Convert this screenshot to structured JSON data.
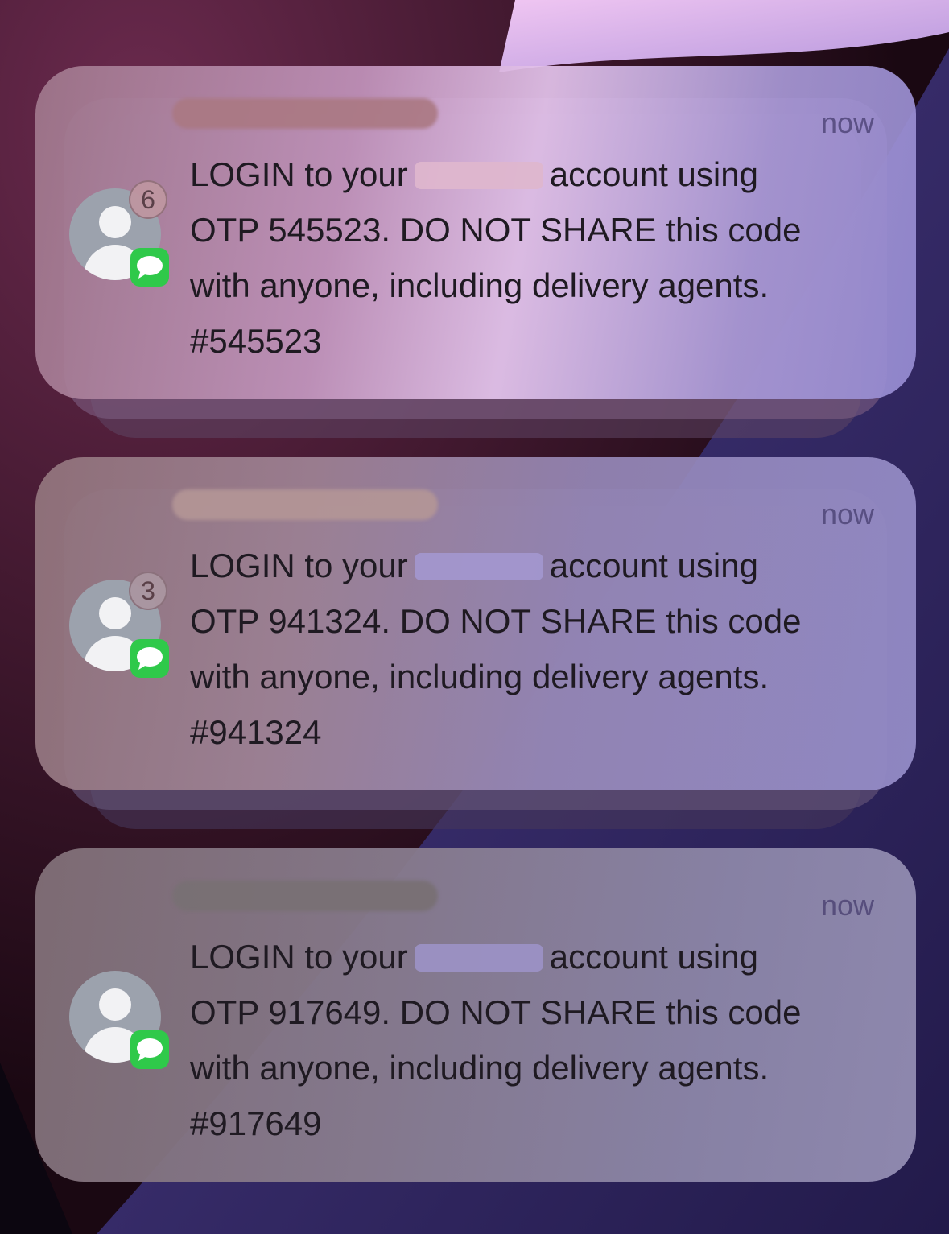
{
  "notifications": [
    {
      "time": "now",
      "count_badge": "6",
      "line1_start": "LOGIN to your",
      "line1_end": "account using",
      "line2": "OTP 545523. DO NOT SHARE this code",
      "line3": "with anyone, including delivery agents.",
      "line4": "#545523"
    },
    {
      "time": "now",
      "count_badge": "3",
      "line1_start": "LOGIN to your",
      "line1_end": "account using",
      "line2": "OTP 941324. DO NOT SHARE this code",
      "line3": "with anyone, including delivery agents.",
      "line4": "#941324"
    },
    {
      "time": "now",
      "line1_start": "LOGIN to your",
      "line1_end": "account using",
      "line2": "OTP 917649. DO NOT SHARE this code",
      "line3": "with anyone, including delivery agents.",
      "line4": "#917649"
    }
  ],
  "icons": {
    "avatar": "contact-avatar-icon",
    "app": "messages-app-icon"
  },
  "colors": {
    "messages_green": "#2fc94a",
    "wallpaper_pink": "#e6b4ec",
    "wallpaper_purple": "#3a2f6e"
  }
}
